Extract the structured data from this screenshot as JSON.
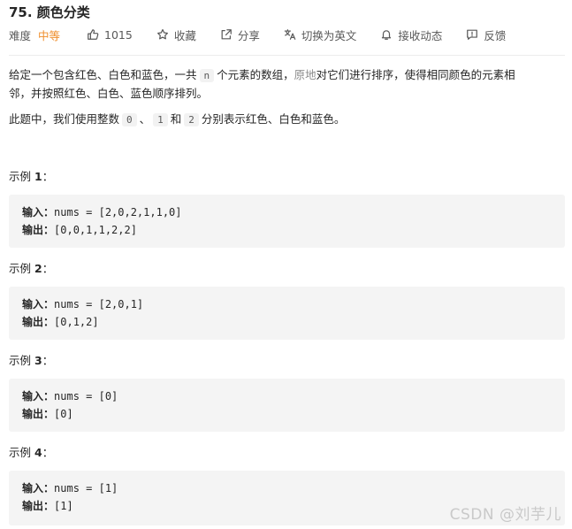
{
  "problem": {
    "title": "75. 颜色分类"
  },
  "meta": {
    "difficulty_label": "难度",
    "difficulty_value": "中等",
    "likes": "1015",
    "favorite": "收藏",
    "share": "分享",
    "switch_lang": "切换为英文",
    "subscribe": "接收动态",
    "feedback": "反馈"
  },
  "description": {
    "p1_a": "给定一个包含红色、白色和蓝色，一共",
    "p1_n": "n",
    "p1_b": "个元素的数组，",
    "p1_inplace": "原地",
    "p1_c": "对它们进行排序，使得相同颜色的元素相",
    "p1_d": "邻，并按照红色、白色、蓝色顺序排列。",
    "p2_a": "此题中，我们使用整数",
    "p2_0": "0",
    "p2_sep1": "、",
    "p2_1": "1",
    "p2_and": "和",
    "p2_2": "2",
    "p2_b": "分别表示红色、白色和蓝色。"
  },
  "examples": [
    {
      "title_prefix": "示例 ",
      "number": "1",
      "title_suffix": "：",
      "input_label": "输入：",
      "input": "nums = [2,0,2,1,1,0]",
      "output_label": "输出：",
      "output": "[0,0,1,1,2,2]"
    },
    {
      "title_prefix": "示例 ",
      "number": "2",
      "title_suffix": "：",
      "input_label": "输入：",
      "input": "nums = [2,0,1]",
      "output_label": "输出：",
      "output": "[0,1,2]"
    },
    {
      "title_prefix": "示例 ",
      "number": "3",
      "title_suffix": "：",
      "input_label": "输入：",
      "input": "nums = [0]",
      "output_label": "输出：",
      "output": "[0]"
    },
    {
      "title_prefix": "示例 ",
      "number": "4",
      "title_suffix": "：",
      "input_label": "输入：",
      "input": "nums = [1]",
      "output_label": "输出：",
      "output": "[1]"
    }
  ],
  "watermark": "CSDN @刘芋儿",
  "colors": {
    "difficulty": "#ef8d2b",
    "code_bg": "#f4f4f4",
    "muted": "#8c8c8c"
  },
  "icons": [
    "thumbs-up-icon",
    "star-icon",
    "share-icon",
    "translate-icon",
    "bell-icon",
    "feedback-icon"
  ]
}
